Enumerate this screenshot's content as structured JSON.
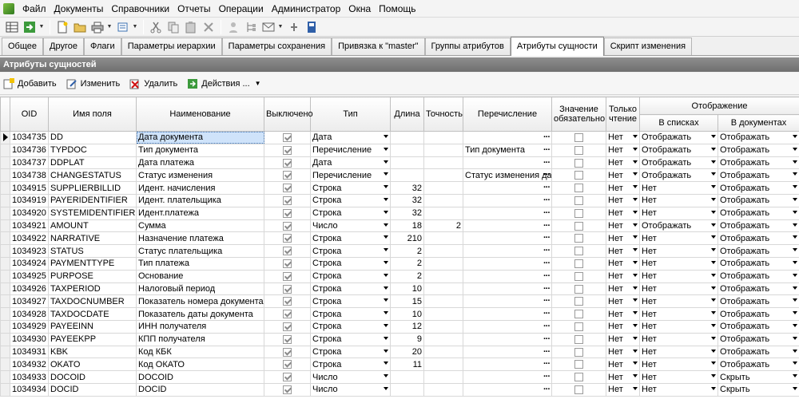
{
  "menu": [
    "Файл",
    "Документы",
    "Справочники",
    "Отчеты",
    "Операции",
    "Администратор",
    "Окна",
    "Помощь"
  ],
  "tabs": [
    {
      "label": "Общее",
      "active": false
    },
    {
      "label": "Другое",
      "active": false
    },
    {
      "label": "Флаги",
      "active": false
    },
    {
      "label": "Параметры иерархии",
      "active": false
    },
    {
      "label": "Параметры сохранения",
      "active": false
    },
    {
      "label": "Привязка к \"master\"",
      "active": false
    },
    {
      "label": "Группы атрибутов",
      "active": false
    },
    {
      "label": "Атрибуты сущности",
      "active": true
    },
    {
      "label": "Скрипт изменения",
      "active": false
    }
  ],
  "section_title": "Атрибуты сущностей",
  "actions": {
    "add": "Добавить",
    "edit": "Изменить",
    "delete": "Удалить",
    "more": "Действия ..."
  },
  "headers": {
    "oid": "OID",
    "field": "Имя поля",
    "name": "Наименование",
    "enabled": "Выключено",
    "type": "Тип",
    "length": "Длина",
    "precision": "Точность",
    "enum": "Перечисление",
    "required": "Значение обязательно",
    "readonly": "Только чтение",
    "display": "Отображение",
    "in_lists": "В списках",
    "in_docs": "В документах"
  },
  "rows": [
    {
      "oid": "1034735",
      "field": "DD",
      "name": "Дата документа",
      "type": "Дата",
      "length": "",
      "precision": "",
      "enum": "",
      "readonly": "Нет",
      "lists": "Отображать",
      "docs": "Отображать"
    },
    {
      "oid": "1034736",
      "field": "TYPDOC",
      "name": "Тип документа",
      "type": "Перечисление",
      "length": "",
      "precision": "",
      "enum": "Тип документа",
      "readonly": "Нет",
      "lists": "Отображать",
      "docs": "Отображать"
    },
    {
      "oid": "1034737",
      "field": "DDPLAT",
      "name": "Дата платежа",
      "type": "Дата",
      "length": "",
      "precision": "",
      "enum": "",
      "readonly": "Нет",
      "lists": "Отображать",
      "docs": "Отображать"
    },
    {
      "oid": "1034738",
      "field": "CHANGESTATUS",
      "name": "Статус изменения",
      "type": "Перечисление",
      "length": "",
      "precision": "",
      "enum": "Статус изменения да",
      "readonly": "Нет",
      "lists": "Отображать",
      "docs": "Отображать"
    },
    {
      "oid": "1034915",
      "field": "SUPPLIERBILLID",
      "name": "Идент. начисления",
      "type": "Строка",
      "length": "32",
      "precision": "",
      "enum": "",
      "readonly": "Нет",
      "lists": "Нет",
      "docs": "Отображать"
    },
    {
      "oid": "1034919",
      "field": "PAYERIDENTIFIER",
      "name": "Идент. плательщика",
      "type": "Строка",
      "length": "32",
      "precision": "",
      "enum": "",
      "readonly": "Нет",
      "lists": "Нет",
      "docs": "Отображать"
    },
    {
      "oid": "1034920",
      "field": "SYSTEMIDENTIFIER",
      "name": "Идент.платежа",
      "type": "Строка",
      "length": "32",
      "precision": "",
      "enum": "",
      "readonly": "Нет",
      "lists": "Нет",
      "docs": "Отображать"
    },
    {
      "oid": "1034921",
      "field": "AMOUNT",
      "name": "Сумма",
      "type": "Число",
      "length": "18",
      "precision": "2",
      "enum": "",
      "readonly": "Нет",
      "lists": "Отображать",
      "docs": "Отображать"
    },
    {
      "oid": "1034922",
      "field": "NARRATIVE",
      "name": "Назначение платежа",
      "type": "Строка",
      "length": "210",
      "precision": "",
      "enum": "",
      "readonly": "Нет",
      "lists": "Нет",
      "docs": "Отображать"
    },
    {
      "oid": "1034923",
      "field": "STATUS",
      "name": "Статус плательщика",
      "type": "Строка",
      "length": "2",
      "precision": "",
      "enum": "",
      "readonly": "Нет",
      "lists": "Нет",
      "docs": "Отображать"
    },
    {
      "oid": "1034924",
      "field": "PAYMENTTYPE",
      "name": "Тип платежа",
      "type": "Строка",
      "length": "2",
      "precision": "",
      "enum": "",
      "readonly": "Нет",
      "lists": "Нет",
      "docs": "Отображать"
    },
    {
      "oid": "1034925",
      "field": "PURPOSE",
      "name": "Основание",
      "type": "Строка",
      "length": "2",
      "precision": "",
      "enum": "",
      "readonly": "Нет",
      "lists": "Нет",
      "docs": "Отображать"
    },
    {
      "oid": "1034926",
      "field": "TAXPERIOD",
      "name": "Налоговый период",
      "type": "Строка",
      "length": "10",
      "precision": "",
      "enum": "",
      "readonly": "Нет",
      "lists": "Нет",
      "docs": "Отображать"
    },
    {
      "oid": "1034927",
      "field": "TAXDOCNUMBER",
      "name": "Показатель номера документа",
      "type": "Строка",
      "length": "15",
      "precision": "",
      "enum": "",
      "readonly": "Нет",
      "lists": "Нет",
      "docs": "Отображать"
    },
    {
      "oid": "1034928",
      "field": "TAXDOCDATE",
      "name": "Показатель даты документа",
      "type": "Строка",
      "length": "10",
      "precision": "",
      "enum": "",
      "readonly": "Нет",
      "lists": "Нет",
      "docs": "Отображать"
    },
    {
      "oid": "1034929",
      "field": "PAYEEINN",
      "name": "ИНН получателя",
      "type": "Строка",
      "length": "12",
      "precision": "",
      "enum": "",
      "readonly": "Нет",
      "lists": "Нет",
      "docs": "Отображать"
    },
    {
      "oid": "1034930",
      "field": "PAYEEKPP",
      "name": "КПП получателя",
      "type": "Строка",
      "length": "9",
      "precision": "",
      "enum": "",
      "readonly": "Нет",
      "lists": "Нет",
      "docs": "Отображать"
    },
    {
      "oid": "1034931",
      "field": "KBK",
      "name": "Код КБК",
      "type": "Строка",
      "length": "20",
      "precision": "",
      "enum": "",
      "readonly": "Нет",
      "lists": "Нет",
      "docs": "Отображать"
    },
    {
      "oid": "1034932",
      "field": "OKATO",
      "name": "Код ОКАТО",
      "type": "Строка",
      "length": "11",
      "precision": "",
      "enum": "",
      "readonly": "Нет",
      "lists": "Нет",
      "docs": "Отображать"
    },
    {
      "oid": "1034933",
      "field": "DOCOID",
      "name": "DOCOID",
      "type": "Число",
      "length": "",
      "precision": "",
      "enum": "",
      "readonly": "Нет",
      "lists": "Нет",
      "docs": "Скрыть"
    },
    {
      "oid": "1034934",
      "field": "DOCID",
      "name": "DOCID",
      "type": "Число",
      "length": "",
      "precision": "",
      "enum": "",
      "readonly": "Нет",
      "lists": "Нет",
      "docs": "Скрыть"
    }
  ],
  "selected_row": 0,
  "colors": {
    "section_header": "#7a7a7a",
    "selection": "#cfe3fa"
  }
}
